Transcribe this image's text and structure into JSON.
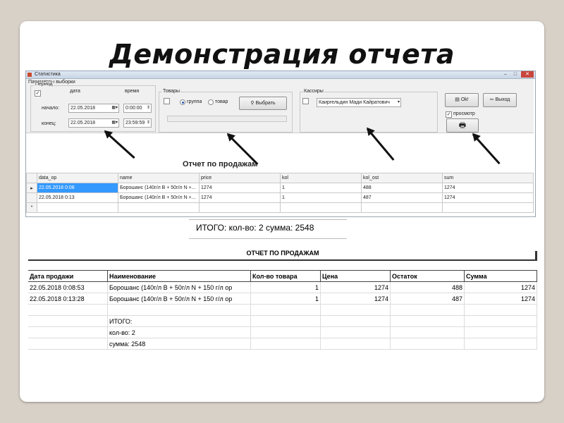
{
  "slide": {
    "title": "Демонстрация отчета"
  },
  "window": {
    "title": "Статистика",
    "params_label": "Параметры выборки",
    "period": {
      "label": "Период",
      "date_label": "дата",
      "time_label": "время",
      "start_label": "начало:",
      "end_label": "конец:",
      "start_date": "22.05.2018",
      "end_date": "22.05.2018",
      "start_time": "0:00:00",
      "end_time": "23:59:59",
      "enabled": "✓"
    },
    "goods": {
      "label": "Товары",
      "radio_group": "группа",
      "radio_goods": "товар",
      "select_button": "Выбрать"
    },
    "cashiers": {
      "label": "Кассиры",
      "selected": "Каиргельдин Мади Кайратович"
    },
    "ok_button": "Ok!",
    "exit_button": "Выход",
    "preview_label": "просмотр",
    "preview_checked": "✓",
    "report_heading": "Отчет по продажам",
    "grid": {
      "columns": [
        "data_op",
        "name",
        "price",
        "kol",
        "kol_ost",
        "sum"
      ],
      "rows": [
        [
          "22.05.2018 0:08",
          "Борошанс   (140г/л В + 50г/л N +...",
          "1274",
          "1",
          "488",
          "1274"
        ],
        [
          "22.05.2018 0:13",
          "Борошанс   (140г/л В + 50г/л N +...",
          "1274",
          "1",
          "487",
          "1274"
        ]
      ],
      "current_marker": "▸",
      "new_marker": "*"
    }
  },
  "total_line": "ИТОГО:    кол-во: 2  сумма: 2548",
  "document": {
    "title": "ОТЧЕТ ПО ПРОДАЖАМ",
    "headers": [
      "Дата продажи",
      "Наименование",
      "Кол-во товара",
      "Цена",
      "Остаток",
      "Сумма"
    ],
    "rows": [
      [
        "22.05.2018 0:08:53",
        "Борошанс    (140г/л В + 50г/л N + 150 г/л ор",
        "1",
        "1274",
        "488",
        "1274"
      ],
      [
        "22.05.2018 0:13:28",
        "Борошанс    (140г/л В + 50г/л N + 150 г/л ор",
        "1",
        "1274",
        "487",
        "1274"
      ]
    ],
    "summary": [
      "ИТОГО:",
      "кол-во: 2",
      "сумма: 2548"
    ]
  }
}
